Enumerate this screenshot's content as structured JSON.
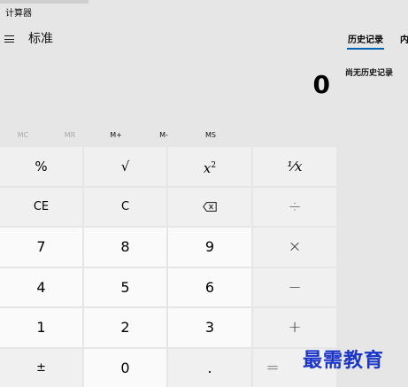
{
  "app": {
    "title": "计算器",
    "mode": "标准"
  },
  "display": {
    "value": "0"
  },
  "memory_buttons": [
    {
      "label": "MC",
      "enabled": false
    },
    {
      "label": "MR",
      "enabled": false
    },
    {
      "label": "M+",
      "enabled": true
    },
    {
      "label": "M-",
      "enabled": true
    },
    {
      "label": "MS",
      "enabled": true
    }
  ],
  "keys": {
    "percent": "%",
    "sqrt": "√",
    "square_base": "x",
    "square_exp": "2",
    "reciprocal": "¹⁄x",
    "ce": "CE",
    "clear": "C",
    "backspace_icon": "backspace-icon",
    "divide": "÷",
    "seven": "7",
    "eight": "8",
    "nine": "9",
    "multiply": "×",
    "four": "4",
    "five": "5",
    "six": "6",
    "minus": "−",
    "one": "1",
    "two": "2",
    "three": "3",
    "plus": "+",
    "negate": "±",
    "zero": "0",
    "decimal": ".",
    "equals": "="
  },
  "side_panel": {
    "history_tab": "历史记录",
    "memory_tab": "内",
    "empty_message": "尚无历史记录"
  },
  "watermark": "最需教育",
  "colors": {
    "accent": "#0063b1",
    "watermark": "#1a35c7"
  }
}
